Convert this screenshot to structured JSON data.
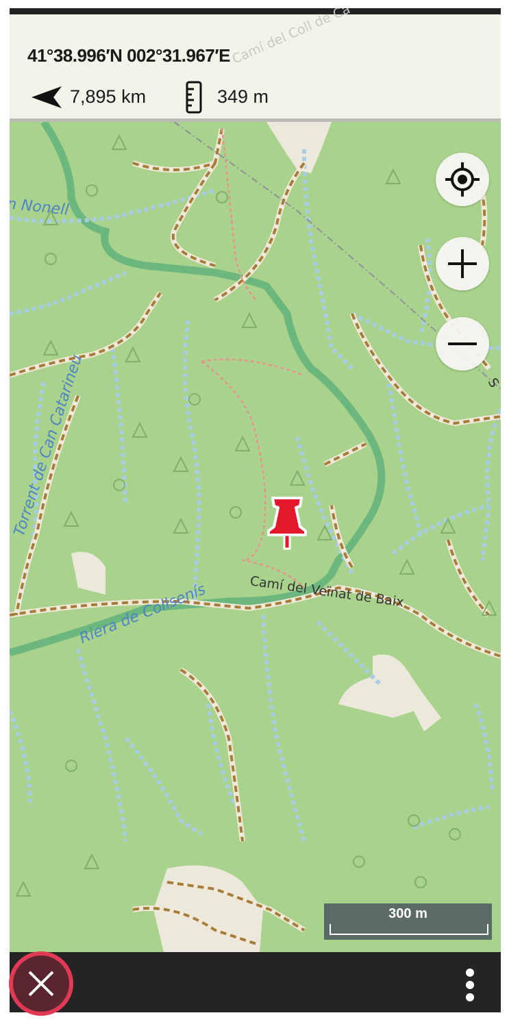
{
  "header": {
    "coordinates": "41°38.996′N 002°31.967′E",
    "distance": "7,895 km",
    "altitude": "349 m"
  },
  "map": {
    "labels": {
      "nonell": "n Nonell",
      "torrent": "Torrent de Can Catarineu",
      "riera": "Riera de Collsenís",
      "cami_veinat": "Camí del Veïnat de Baix",
      "cami_coll": "Camí del Coll de Ca",
      "edge_s": "S"
    },
    "scale": "300 m",
    "colors": {
      "forest": "#a9d38c",
      "stream": "#a7cde4",
      "track": "#a67c3a",
      "path": "#e8918a",
      "river": "#6cb77d",
      "pin": "#e3182d"
    }
  },
  "controls": {
    "locate_icon": "crosshair-icon",
    "zoom_in_icon": "plus-icon",
    "zoom_out_icon": "minus-icon",
    "close_icon": "close-icon",
    "more_icon": "more-vertical-icon"
  }
}
